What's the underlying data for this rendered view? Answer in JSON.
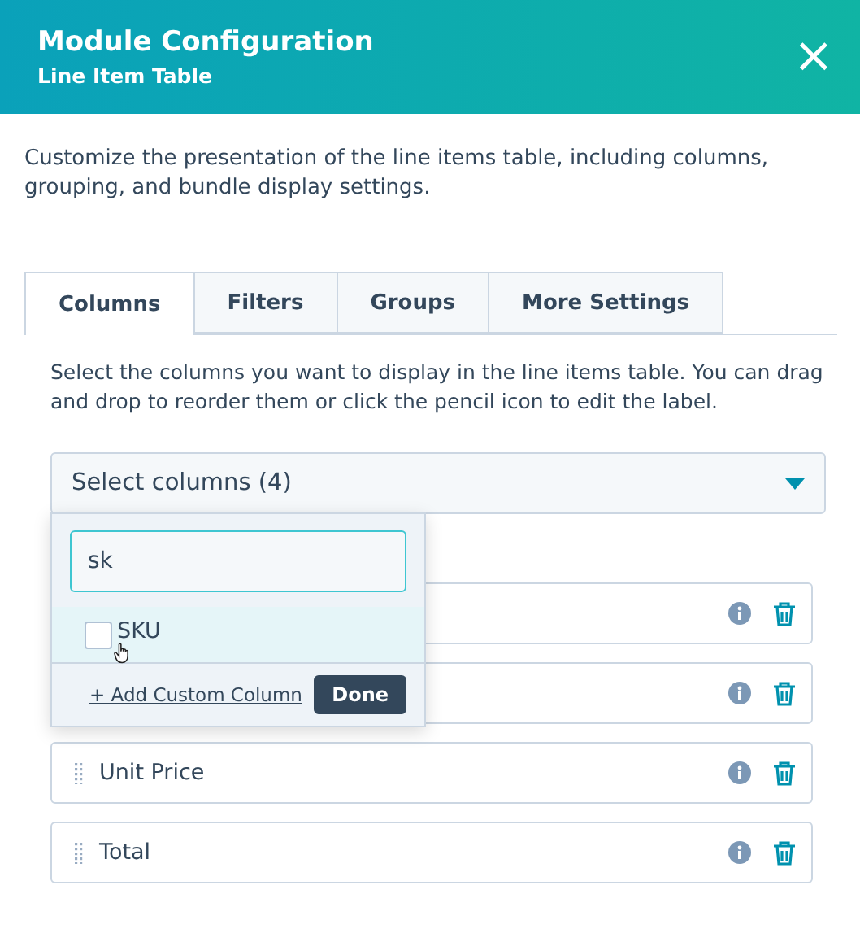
{
  "header": {
    "title": "Module Configuration",
    "subtitle": "Line Item Table",
    "close": "×"
  },
  "description": "Customize the presentation of the line items table, including columns, grouping, and bundle display settings.",
  "tabs": [
    {
      "label": "Columns",
      "selected": true
    },
    {
      "label": "Filters",
      "selected": false
    },
    {
      "label": "Groups",
      "selected": false
    },
    {
      "label": "More Settings",
      "selected": false
    }
  ],
  "help": "Select the columns you want to display in the line items table. You can drag and drop to reorder them or click the pencil icon to edit the label.",
  "select": {
    "value": "Select columns (4)"
  },
  "popover": {
    "search": "sk",
    "options": [
      {
        "label": "SKU",
        "checked": false
      }
    ],
    "add_link": "+ Add Custom Column",
    "done": "Done"
  },
  "rows": [
    {},
    {},
    {
      "label": "Unit Price"
    },
    {
      "label": "Total"
    }
  ]
}
